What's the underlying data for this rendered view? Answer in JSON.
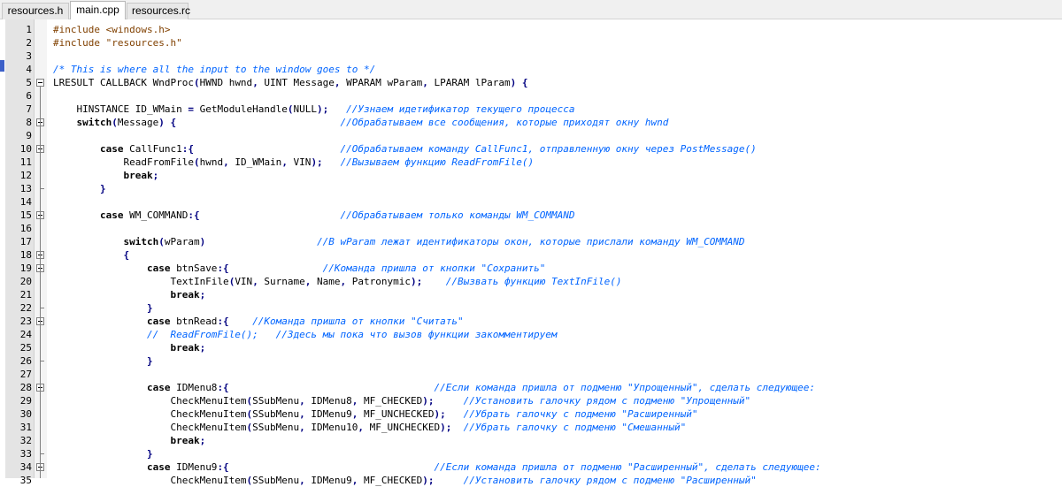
{
  "tabs": [
    {
      "label": "resources.h",
      "active": false
    },
    {
      "label": "main.cpp",
      "active": true
    },
    {
      "label": "resources.rc",
      "active": false
    }
  ],
  "colors": {
    "keyword": "#000000",
    "preprocessor": "#804000",
    "comment": "#0064ff",
    "operator": "#000080",
    "gutter": "#e4e4e4",
    "fold_marker": "#808080"
  },
  "lines": [
    {
      "n": "1",
      "tokens": [
        [
          "pp",
          "#include <windows.h>"
        ]
      ]
    },
    {
      "n": "2",
      "tokens": [
        [
          "pp",
          "#include \"resources.h\""
        ]
      ]
    },
    {
      "n": "3",
      "tokens": []
    },
    {
      "n": "4",
      "tokens": [
        [
          "cm",
          "/* This is where all the input to the window goes to */"
        ]
      ]
    },
    {
      "n": "5",
      "fold": "open",
      "tokens": [
        [
          "id",
          "LRESULT CALLBACK WndProc"
        ],
        [
          "pun",
          "("
        ],
        [
          "id",
          "HWND hwnd"
        ],
        [
          "pun",
          ","
        ],
        [
          "id",
          " UINT Message"
        ],
        [
          "pun",
          ","
        ],
        [
          "id",
          " WPARAM wParam"
        ],
        [
          "pun",
          ","
        ],
        [
          "id",
          " LPARAM lParam"
        ],
        [
          "pun",
          ")"
        ],
        [
          "id",
          " "
        ],
        [
          "pun",
          "{"
        ]
      ]
    },
    {
      "n": "6",
      "tokens": []
    },
    {
      "n": "7",
      "tokens": [
        [
          "id",
          "    HINSTANCE ID_WMain "
        ],
        [
          "pun",
          "="
        ],
        [
          "id",
          " GetModuleHandle"
        ],
        [
          "pun",
          "("
        ],
        [
          "id",
          "NULL"
        ],
        [
          "pun",
          ");"
        ],
        [
          "id",
          "   "
        ],
        [
          "cm",
          "//Узнаем идетификатор текущего процесса"
        ]
      ]
    },
    {
      "n": "8",
      "fold": "open",
      "tokens": [
        [
          "kw",
          "    switch"
        ],
        [
          "pun",
          "("
        ],
        [
          "id",
          "Message"
        ],
        [
          "pun",
          ")"
        ],
        [
          "id",
          " "
        ],
        [
          "pun",
          "{"
        ],
        [
          "id",
          "                            "
        ],
        [
          "cm",
          "//Обрабатываем все сообщения, которые приходят окну hwnd"
        ]
      ]
    },
    {
      "n": "9",
      "tokens": []
    },
    {
      "n": "10",
      "fold": "open",
      "tokens": [
        [
          "kw",
          "        case"
        ],
        [
          "id",
          " CallFunc1"
        ],
        [
          "pun",
          ":{"
        ],
        [
          "id",
          "                         "
        ],
        [
          "cm",
          "//Обрабатываем команду CallFunc1, отправленную окну через PostMessage()"
        ]
      ]
    },
    {
      "n": "11",
      "tokens": [
        [
          "id",
          "            ReadFromFile"
        ],
        [
          "pun",
          "("
        ],
        [
          "id",
          "hwnd"
        ],
        [
          "pun",
          ","
        ],
        [
          "id",
          " ID_WMain"
        ],
        [
          "pun",
          ","
        ],
        [
          "id",
          " VIN"
        ],
        [
          "pun",
          ");"
        ],
        [
          "id",
          "   "
        ],
        [
          "cm",
          "//Вызываем функцию ReadFromFile()"
        ]
      ]
    },
    {
      "n": "12",
      "tokens": [
        [
          "kw",
          "            break"
        ],
        [
          "pun",
          ";"
        ]
      ]
    },
    {
      "n": "13",
      "tokens": [
        [
          "pun",
          "        }"
        ]
      ]
    },
    {
      "n": "14",
      "tokens": []
    },
    {
      "n": "15",
      "fold": "open",
      "tokens": [
        [
          "kw",
          "        case"
        ],
        [
          "id",
          " WM_COMMAND"
        ],
        [
          "pun",
          ":{"
        ],
        [
          "id",
          "                        "
        ],
        [
          "cm",
          "//Обрабатываем только команды WM_COMMAND"
        ]
      ]
    },
    {
      "n": "16",
      "tokens": []
    },
    {
      "n": "17",
      "tokens": [
        [
          "kw",
          "            switch"
        ],
        [
          "pun",
          "("
        ],
        [
          "id",
          "wParam"
        ],
        [
          "pun",
          ")"
        ],
        [
          "id",
          "                   "
        ],
        [
          "cm",
          "//В wParam лежат идентификаторы окон, которые прислали команду WM_COMMAND"
        ]
      ]
    },
    {
      "n": "18",
      "fold": "open",
      "tokens": [
        [
          "pun",
          "            {"
        ]
      ]
    },
    {
      "n": "19",
      "fold": "open",
      "tokens": [
        [
          "kw",
          "                case"
        ],
        [
          "id",
          " btnSave"
        ],
        [
          "pun",
          ":{"
        ],
        [
          "id",
          "                "
        ],
        [
          "cm",
          "//Команда пришла от кнопки \"Сохранить\""
        ]
      ]
    },
    {
      "n": "20",
      "tokens": [
        [
          "id",
          "                    TextInFile"
        ],
        [
          "pun",
          "("
        ],
        [
          "id",
          "VIN"
        ],
        [
          "pun",
          ","
        ],
        [
          "id",
          " Surname"
        ],
        [
          "pun",
          ","
        ],
        [
          "id",
          " Name"
        ],
        [
          "pun",
          ","
        ],
        [
          "id",
          " Patronymic"
        ],
        [
          "pun",
          ");"
        ],
        [
          "id",
          "    "
        ],
        [
          "cm",
          "//Вызвать функцию TextInFile()"
        ]
      ]
    },
    {
      "n": "21",
      "tokens": [
        [
          "kw",
          "                    break"
        ],
        [
          "pun",
          ";"
        ]
      ]
    },
    {
      "n": "22",
      "tokens": [
        [
          "pun",
          "                }"
        ]
      ]
    },
    {
      "n": "23",
      "fold": "open",
      "tokens": [
        [
          "kw",
          "                case"
        ],
        [
          "id",
          " btnRead"
        ],
        [
          "pun",
          ":{"
        ],
        [
          "id",
          "    "
        ],
        [
          "cm",
          "//Команда пришла от кнопки \"Считать\""
        ]
      ]
    },
    {
      "n": "24",
      "tokens": [
        [
          "cm",
          "                //  ReadFromFile();   //Здесь мы пока что вызов функции закомментируем"
        ]
      ]
    },
    {
      "n": "25",
      "tokens": [
        [
          "kw",
          "                    break"
        ],
        [
          "pun",
          ";"
        ]
      ]
    },
    {
      "n": "26",
      "tokens": [
        [
          "pun",
          "                }"
        ]
      ]
    },
    {
      "n": "27",
      "tokens": []
    },
    {
      "n": "28",
      "fold": "open",
      "tokens": [
        [
          "kw",
          "                case"
        ],
        [
          "id",
          " IDMenu8"
        ],
        [
          "pun",
          ":{"
        ],
        [
          "id",
          "                                   "
        ],
        [
          "cm",
          "//Если команда пришла от подменю \"Упрощенный\", сделать следующее:"
        ]
      ]
    },
    {
      "n": "29",
      "tokens": [
        [
          "id",
          "                    CheckMenuItem"
        ],
        [
          "pun",
          "("
        ],
        [
          "id",
          "SSubMenu"
        ],
        [
          "pun",
          ","
        ],
        [
          "id",
          " IDMenu8"
        ],
        [
          "pun",
          ","
        ],
        [
          "id",
          " MF_CHECKED"
        ],
        [
          "pun",
          ");"
        ],
        [
          "id",
          "     "
        ],
        [
          "cm",
          "//Установить галочку рядом с подменю \"Упрощенный\""
        ]
      ]
    },
    {
      "n": "30",
      "tokens": [
        [
          "id",
          "                    CheckMenuItem"
        ],
        [
          "pun",
          "("
        ],
        [
          "id",
          "SSubMenu"
        ],
        [
          "pun",
          ","
        ],
        [
          "id",
          " IDMenu9"
        ],
        [
          "pun",
          ","
        ],
        [
          "id",
          " MF_UNCHECKED"
        ],
        [
          "pun",
          ");"
        ],
        [
          "id",
          "   "
        ],
        [
          "cm",
          "//Убрать галочку с подменю \"Расширенный\""
        ]
      ]
    },
    {
      "n": "31",
      "tokens": [
        [
          "id",
          "                    CheckMenuItem"
        ],
        [
          "pun",
          "("
        ],
        [
          "id",
          "SSubMenu"
        ],
        [
          "pun",
          ","
        ],
        [
          "id",
          " IDMenu10"
        ],
        [
          "pun",
          ","
        ],
        [
          "id",
          " MF_UNCHECKED"
        ],
        [
          "pun",
          ");"
        ],
        [
          "id",
          "  "
        ],
        [
          "cm",
          "//Убрать галочку с подменю \"Смешанный\""
        ]
      ]
    },
    {
      "n": "32",
      "tokens": [
        [
          "kw",
          "                    break"
        ],
        [
          "pun",
          ";"
        ]
      ]
    },
    {
      "n": "33",
      "tokens": [
        [
          "pun",
          "                }"
        ]
      ]
    },
    {
      "n": "34",
      "fold": "open",
      "tokens": [
        [
          "kw",
          "                case"
        ],
        [
          "id",
          " IDMenu9"
        ],
        [
          "pun",
          ":{"
        ],
        [
          "id",
          "                                   "
        ],
        [
          "cm",
          "//Если команда пришла от подменю \"Расширенный\", сделать следующее:"
        ]
      ]
    },
    {
      "n": "35",
      "tokens": [
        [
          "id",
          "                    CheckMenuItem"
        ],
        [
          "pun",
          "("
        ],
        [
          "id",
          "SSubMenu"
        ],
        [
          "pun",
          ","
        ],
        [
          "id",
          " IDMenu9"
        ],
        [
          "pun",
          ","
        ],
        [
          "id",
          " MF_CHECKED"
        ],
        [
          "pun",
          ");"
        ],
        [
          "id",
          "     "
        ],
        [
          "cm",
          "//Установить галочку рядом с подменю \"Расширенный\""
        ]
      ]
    }
  ]
}
